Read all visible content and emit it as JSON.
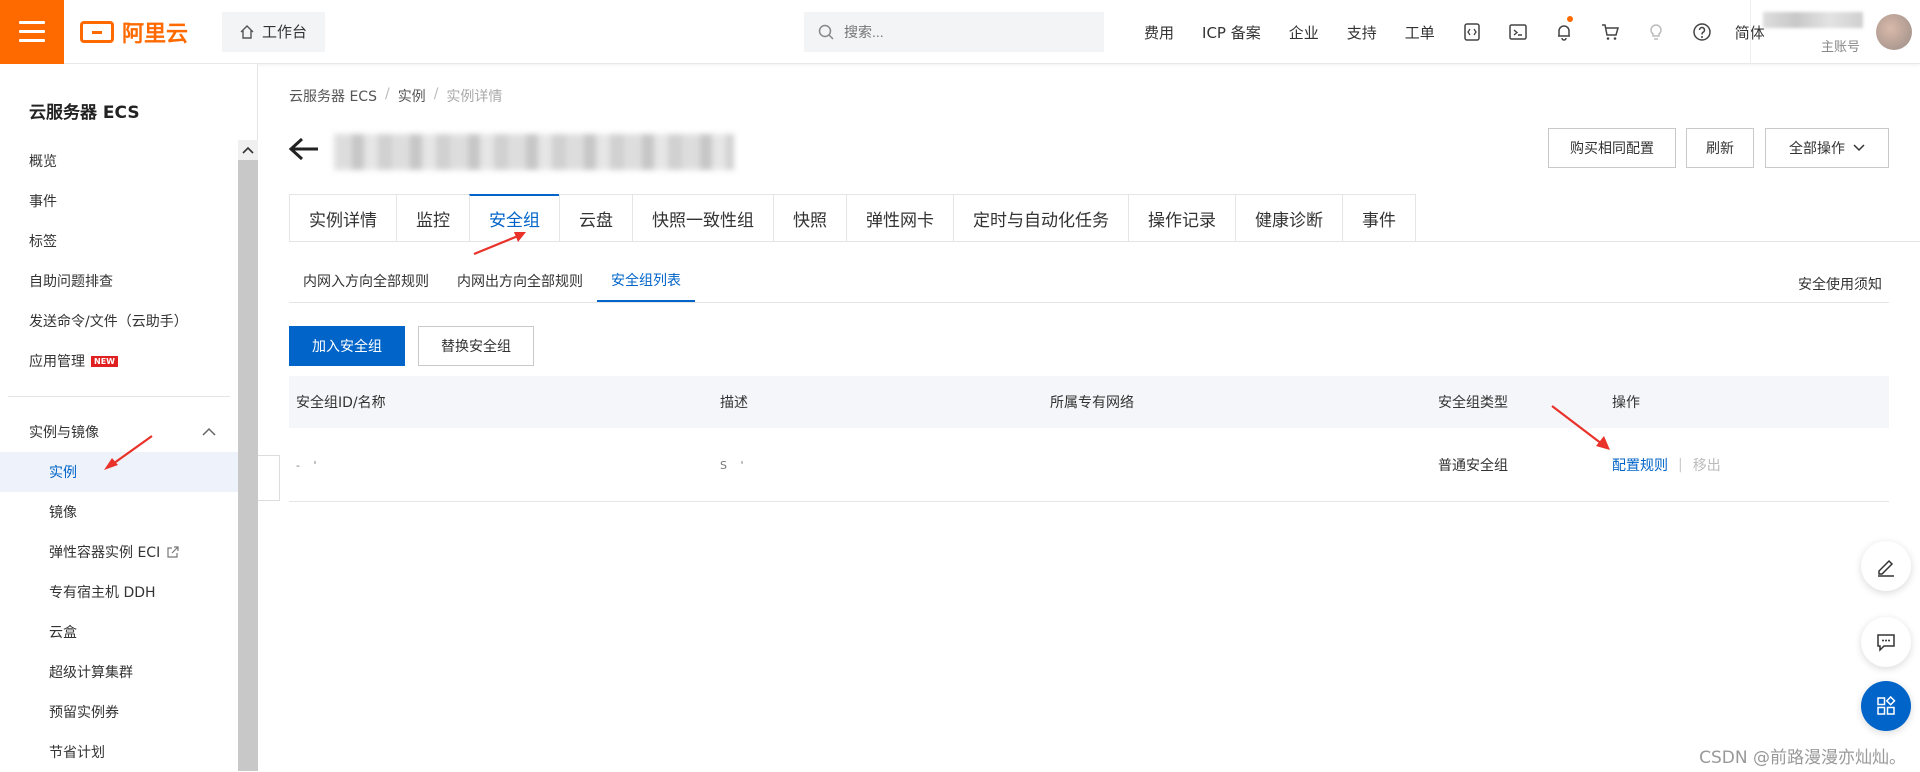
{
  "topbar": {
    "brand": "阿里云",
    "workbench": "工作台",
    "search_placeholder": "搜索...",
    "links": [
      "费用",
      "ICP 备案",
      "企业",
      "支持",
      "工单"
    ],
    "lang": "简体",
    "account_label": "主账号",
    "accent": "#ff6a00"
  },
  "sidebar": {
    "title": "云服务器 ECS",
    "items": [
      "概览",
      "事件",
      "标签",
      "自助问题排查",
      "发送命令/文件（云助手）",
      "应用管理"
    ],
    "new_badge": "NEW",
    "group": "实例与镜像",
    "sub_items": [
      "实例",
      "镜像",
      "弹性容器实例 ECI",
      "专有宿主机 DDH",
      "云盒",
      "超级计算集群",
      "预留实例券",
      "节省计划"
    ]
  },
  "breadcrumb": [
    "云服务器 ECS",
    "实例",
    "实例详情"
  ],
  "header_buttons": {
    "buy": "购买相同配置",
    "refresh": "刷新",
    "all_ops": "全部操作"
  },
  "tabs": [
    "实例详情",
    "监控",
    "安全组",
    "云盘",
    "快照一致性组",
    "快照",
    "弹性网卡",
    "定时与自动化任务",
    "操作记录",
    "健康诊断",
    "事件"
  ],
  "active_tab": "安全组",
  "subtabs": [
    "内网入方向全部规则",
    "内网出方向全部规则",
    "安全组列表"
  ],
  "notice": "安全使用须知",
  "actions": {
    "join": "加入安全组",
    "replace": "替换安全组"
  },
  "table": {
    "headers": [
      "安全组ID/名称",
      "描述",
      "所属专有网络",
      "安全组类型",
      "操作"
    ],
    "row": {
      "id_fragment": "- '",
      "desc_fragment": "S '",
      "vpc": "",
      "type": "普通安全组",
      "op_config": "配置规则",
      "op_remove": "移出"
    }
  },
  "watermark": "CSDN @前路漫漫亦灿灿。",
  "colors": {
    "primary": "#0064c8",
    "annotation": "#e8322a"
  }
}
